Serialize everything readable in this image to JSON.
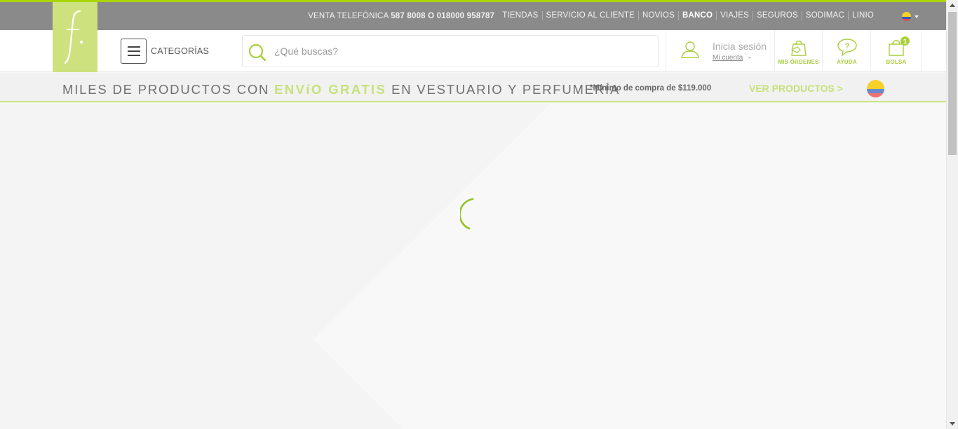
{
  "topbar": {
    "phone_prefix": "VENTA TELEFÓNICA ",
    "phone_numbers": "587 8008 O 018000 958787",
    "links": [
      "TIENDAS",
      "SERVICIO AL CLIENTE",
      "NOVIOS",
      "BANCO",
      "VIAJES",
      "SEGUROS",
      "SODIMAC",
      "LINIO"
    ],
    "bold_link": "BANCO",
    "country_flag_icon": "colombia-flag-icon"
  },
  "header": {
    "logo_letter": "f",
    "categories_label": "CATEGORÍAS",
    "search": {
      "placeholder": "¿Qué buscas?",
      "value": ""
    },
    "account": {
      "login_text": "Inicia sesión",
      "my_account": "Mi cuenta"
    },
    "orders_label": "MIS ÓRDENES",
    "help_label": "AYUDA",
    "help_glyph": "?",
    "bag_label": "BOLSA",
    "bag_count": "1"
  },
  "promo": {
    "text_before": "MILES DE PRODUCTOS CON ",
    "highlight": "ENVíO GRATIS",
    "text_after": " EN VESTUARIO Y PERFUMERÍA",
    "minimum": "*Mínimo de compra de $119.000",
    "cta": "VER PRODUCTOS >"
  },
  "colors": {
    "brand_green": "#aad500",
    "logo_bg": "#cde27e",
    "accent_text": "#c5e27a",
    "topbar_bg": "#8a8a8a"
  },
  "status": {
    "loading": true
  }
}
